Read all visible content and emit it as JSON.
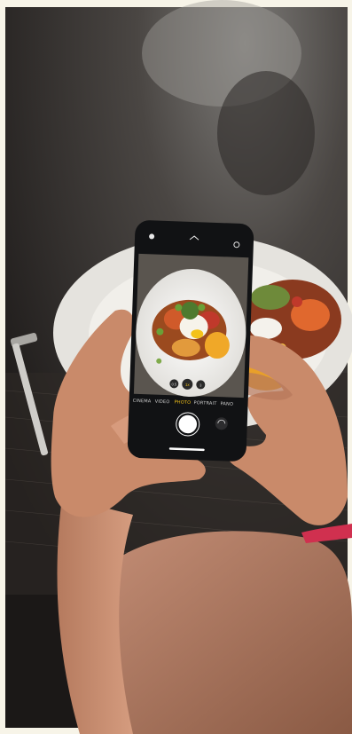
{
  "scene": {
    "description_tag": "photo",
    "colors": {
      "table": "#2a2624",
      "plate": "#e8e6e1",
      "skin": "#c88a6c",
      "phone_body": "#111214",
      "accent_yellow": "#f4c21a"
    }
  },
  "phone_camera": {
    "modes": [
      "CINEMA",
      "VIDEO",
      "PHOTO",
      "PORTRAIT",
      "PANO"
    ],
    "active_mode": "PHOTO",
    "zoom_levels": [
      "0.5",
      "1x",
      "3"
    ]
  },
  "icons": {
    "flash": "flash-icon",
    "live": "live-photo-icon",
    "chevron": "chevron-up-icon",
    "flip": "camera-flip-icon",
    "shutter": "shutter-button"
  }
}
